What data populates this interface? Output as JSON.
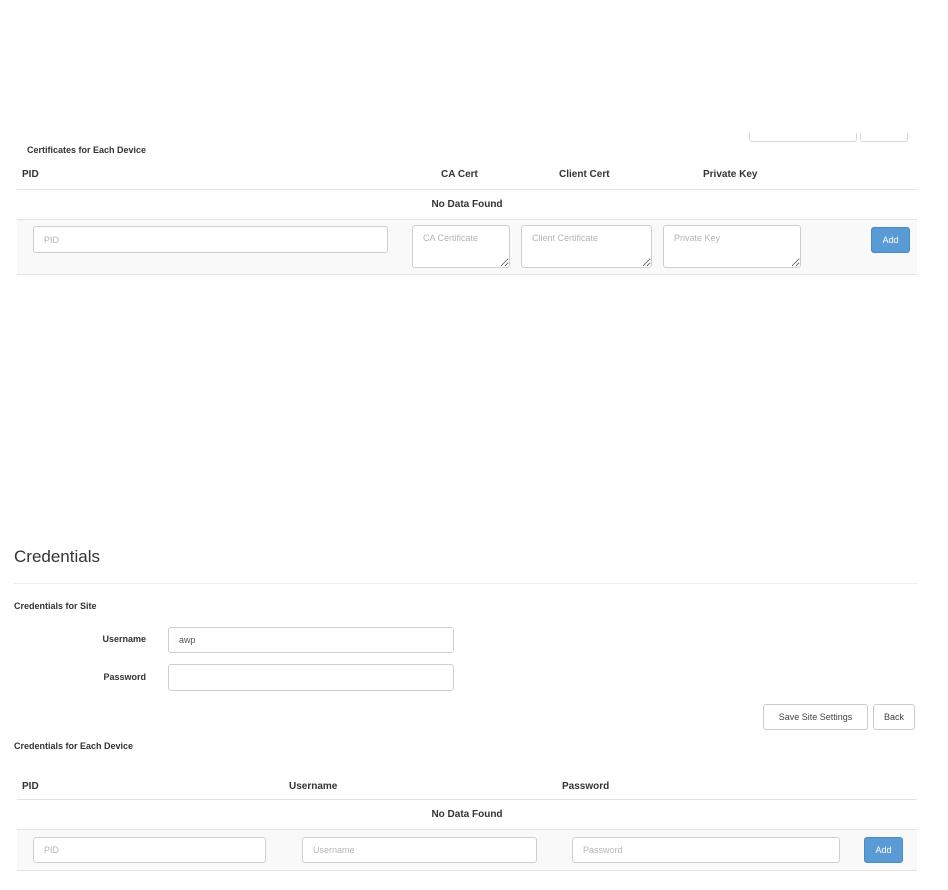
{
  "certificates": {
    "caption": "Certificates for Each Device",
    "columns": {
      "pid": "PID",
      "ca_cert": "CA Cert",
      "client_cert": "Client Cert",
      "private_key": "Private Key"
    },
    "empty_text": "No Data Found",
    "form": {
      "pid_placeholder": "PID",
      "ca_placeholder": "CA Certificate",
      "client_placeholder": "Client Certificate",
      "key_placeholder": "Private Key",
      "add_label": "Add"
    }
  },
  "credentials": {
    "heading": "Credentials",
    "site": {
      "caption": "Credentials for Site",
      "username_label": "Username",
      "username_value": "awp",
      "password_label": "Password",
      "password_value": ""
    },
    "save_label": "Save Site Settings",
    "back_label": "Back",
    "device": {
      "caption": "Credentials for Each Device",
      "columns": {
        "pid": "PID",
        "username": "Username",
        "password": "Password"
      },
      "empty_text": "No Data Found",
      "form": {
        "pid_placeholder": "PID",
        "username_placeholder": "Username",
        "password_placeholder": "Password",
        "add_label": "Add"
      }
    }
  }
}
